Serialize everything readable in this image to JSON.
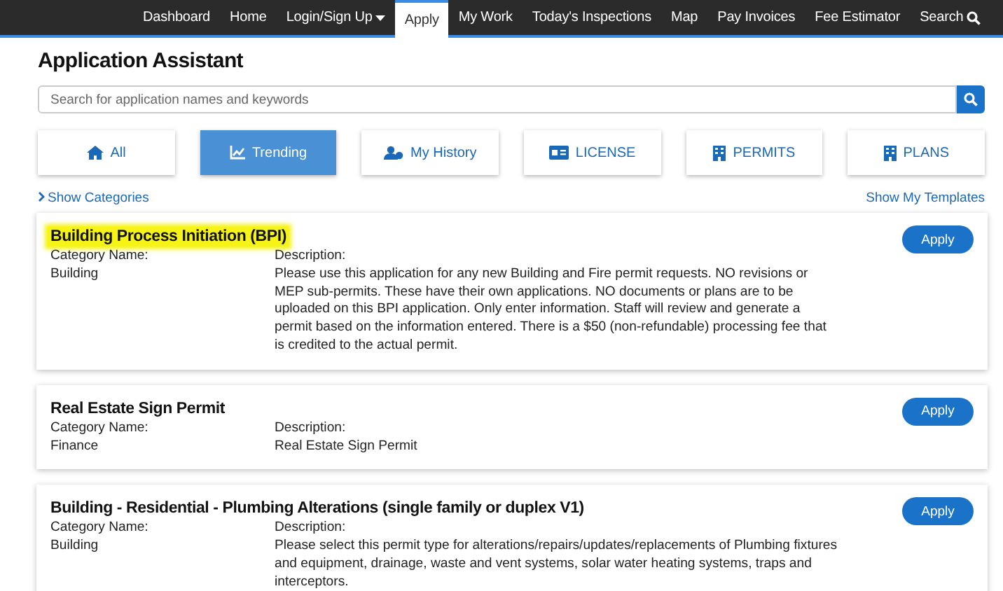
{
  "nav": {
    "items": [
      {
        "label": "Dashboard",
        "selected": false,
        "kind": "link"
      },
      {
        "label": "Home",
        "selected": false,
        "kind": "link"
      },
      {
        "label": "Login/Sign Up",
        "selected": false,
        "kind": "dropdown"
      },
      {
        "label": "Apply",
        "selected": true,
        "kind": "link"
      },
      {
        "label": "My Work",
        "selected": false,
        "kind": "link"
      },
      {
        "label": "Today's Inspections",
        "selected": false,
        "kind": "link"
      },
      {
        "label": "Map",
        "selected": false,
        "kind": "link"
      },
      {
        "label": "Pay Invoices",
        "selected": false,
        "kind": "link"
      },
      {
        "label": "Fee Estimator",
        "selected": false,
        "kind": "link"
      },
      {
        "label": "Search",
        "selected": false,
        "kind": "search"
      }
    ]
  },
  "page_title": "Application Assistant",
  "search": {
    "placeholder": "Search for application names and keywords"
  },
  "categories": [
    {
      "label": "All",
      "kind": "home",
      "selected": false
    },
    {
      "label": "Trending",
      "kind": "chart",
      "selected": true
    },
    {
      "label": "My History",
      "kind": "user",
      "selected": false
    },
    {
      "label": "LICENSE",
      "kind": "card",
      "selected": false
    },
    {
      "label": "PERMITS",
      "kind": "building",
      "selected": false
    },
    {
      "label": "PLANS",
      "kind": "building",
      "selected": false
    }
  ],
  "show_categories": "Show Categories",
  "show_templates": "Show My Templates",
  "applications": [
    {
      "title": "Building Process Initiation (BPI)",
      "highlighted": true,
      "category_label": "Category Name:",
      "category": "Building",
      "description_label": "Description:",
      "description": "Please use this application for any new Building and Fire permit requests. NO revisions or MEP sub-permits. These have their own applications. NO documents or plans are to be uploaded on this BPI application. Only enter information. Staff will review and generate a permit based on the information entered. There is a $50 (non-refundable) processing fee that is credited to the actual permit.",
      "button": "Apply"
    },
    {
      "title": "Real Estate Sign Permit",
      "highlighted": false,
      "category_label": "Category Name:",
      "category": "Finance",
      "description_label": "Description:",
      "description": "Real Estate Sign Permit",
      "button": "Apply"
    },
    {
      "title": "Building - Residential - Plumbing Alterations (single family or duplex V1)",
      "highlighted": false,
      "category_label": "Category Name:",
      "category": "Building",
      "description_label": "Description:",
      "description": "Please select this permit type for alterations/repairs/updates/replacements of Plumbing fixtures and equipment, drainage, waste and vent systems, solar water heating systems, traps and interceptors.",
      "button": "Apply"
    }
  ]
}
